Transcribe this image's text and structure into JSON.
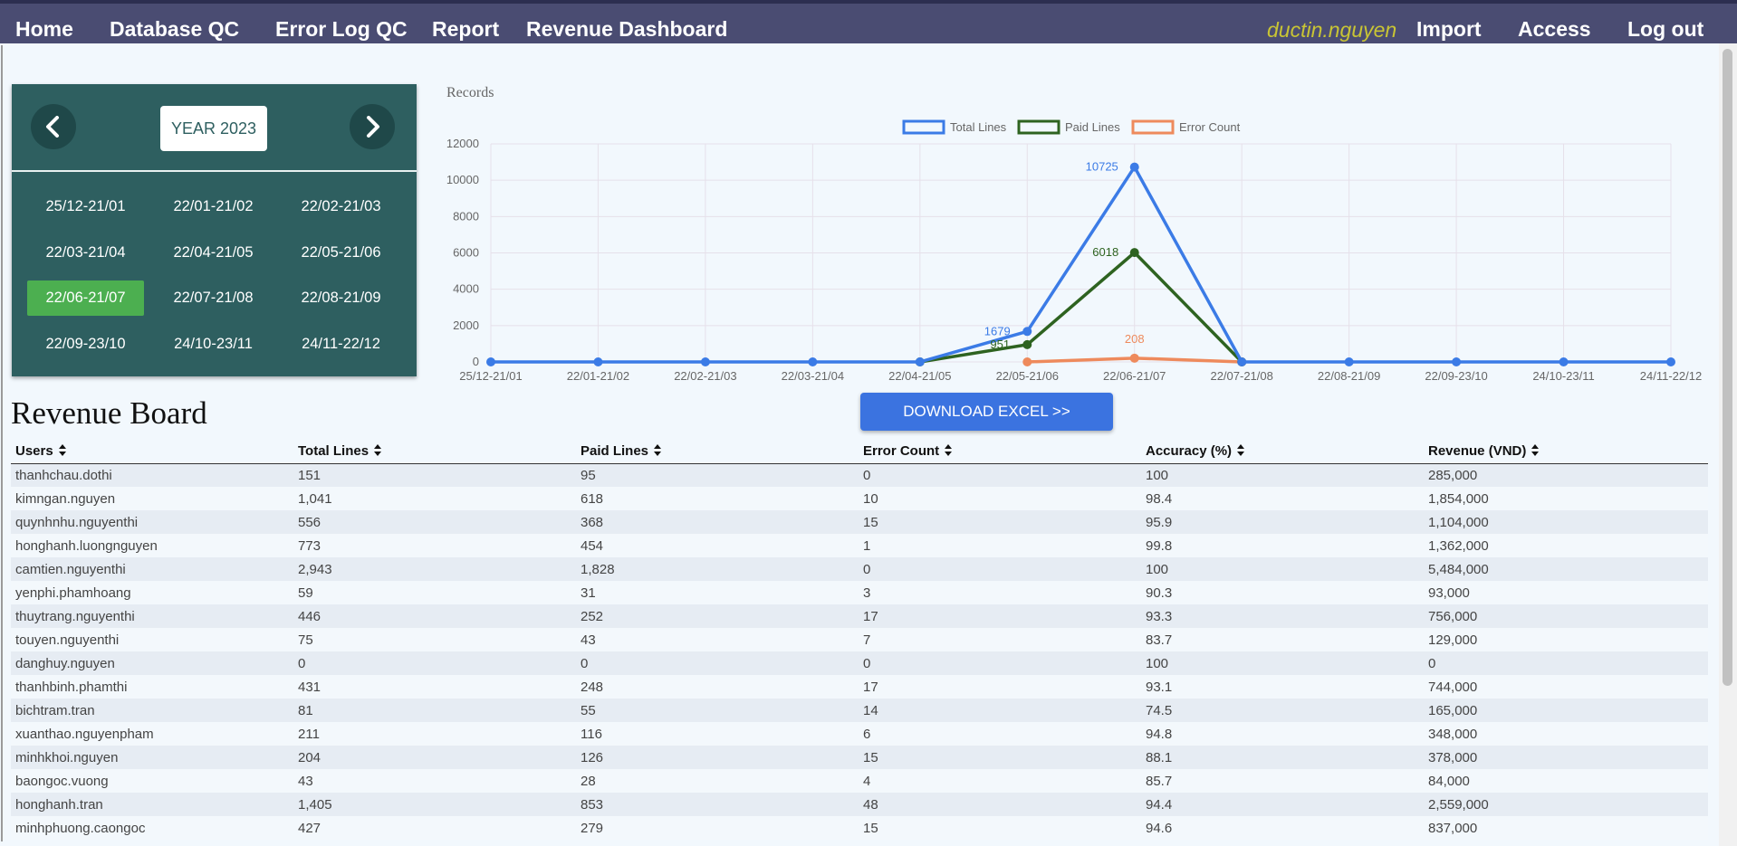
{
  "nav": {
    "items": [
      "Home",
      "Database QC",
      "Error Log QC",
      "Report",
      "Revenue Dashboard"
    ],
    "user": "ductin.nguyen",
    "right_items": [
      "Import",
      "Access",
      "Log out"
    ]
  },
  "calendar": {
    "year_label": "YEAR 2023",
    "periods": [
      "25/12-21/01",
      "22/01-21/02",
      "22/02-21/03",
      "22/03-21/04",
      "22/04-21/05",
      "22/05-21/06",
      "22/06-21/07",
      "22/07-21/08",
      "22/08-21/09",
      "22/09-23/10",
      "24/10-23/11",
      "24/11-22/12"
    ],
    "active_index": 6,
    "active_color": "#4caf50"
  },
  "chart_data": {
    "type": "line",
    "title": "Records",
    "categories": [
      "25/12-21/01",
      "22/01-21/02",
      "22/02-21/03",
      "22/03-21/04",
      "22/04-21/05",
      "22/05-21/06",
      "22/06-21/07",
      "22/07-21/08",
      "22/08-21/09",
      "22/09-23/10",
      "24/10-23/11",
      "24/11-22/12"
    ],
    "ylim": [
      0,
      12000
    ],
    "yticks": [
      0,
      2000,
      4000,
      6000,
      8000,
      10000,
      12000
    ],
    "grid": true,
    "legend": "top",
    "series": [
      {
        "name": "Total Lines",
        "color": "#3b7be6",
        "values": [
          0,
          0,
          0,
          0,
          0,
          1679,
          10725,
          0,
          0,
          0,
          0,
          0
        ],
        "labels": [
          null,
          null,
          null,
          null,
          null,
          "1679",
          "10725",
          null,
          null,
          null,
          null,
          null
        ]
      },
      {
        "name": "Paid Lines",
        "color": "#2e6320",
        "values": [
          null,
          null,
          null,
          null,
          0,
          951,
          6018,
          0,
          null,
          null,
          null,
          null
        ],
        "labels": [
          null,
          null,
          null,
          null,
          null,
          "951",
          "6018",
          null,
          null,
          null,
          null,
          null
        ]
      },
      {
        "name": "Error Count",
        "color": "#ee8a5c",
        "values": [
          null,
          null,
          null,
          null,
          null,
          0,
          208,
          0,
          null,
          null,
          null,
          null
        ],
        "labels": [
          null,
          null,
          null,
          null,
          null,
          null,
          "208",
          null,
          null,
          null,
          null,
          null
        ]
      }
    ]
  },
  "download_label": "DOWNLOAD EXCEL >>",
  "board": {
    "title": "Revenue Board",
    "columns": [
      "Users",
      "Total Lines",
      "Paid Lines",
      "Error Count",
      "Accuracy (%)",
      "Revenue (VND)"
    ],
    "rows": [
      [
        "thanhchau.dothi",
        "151",
        "95",
        "0",
        "100",
        "285,000"
      ],
      [
        "kimngan.nguyen",
        "1,041",
        "618",
        "10",
        "98.4",
        "1,854,000"
      ],
      [
        "quynhnhu.nguyenthi",
        "556",
        "368",
        "15",
        "95.9",
        "1,104,000"
      ],
      [
        "honghanh.luongnguyen",
        "773",
        "454",
        "1",
        "99.8",
        "1,362,000"
      ],
      [
        "camtien.nguyenthi",
        "2,943",
        "1,828",
        "0",
        "100",
        "5,484,000"
      ],
      [
        "yenphi.phamhoang",
        "59",
        "31",
        "3",
        "90.3",
        "93,000"
      ],
      [
        "thuytrang.nguyenthi",
        "446",
        "252",
        "17",
        "93.3",
        "756,000"
      ],
      [
        "touyen.nguyenthi",
        "75",
        "43",
        "7",
        "83.7",
        "129,000"
      ],
      [
        "danghuy.nguyen",
        "0",
        "0",
        "0",
        "100",
        "0"
      ],
      [
        "thanhbinh.phamthi",
        "431",
        "248",
        "17",
        "93.1",
        "744,000"
      ],
      [
        "bichtram.tran",
        "81",
        "55",
        "14",
        "74.5",
        "165,000"
      ],
      [
        "xuanthao.nguyenpham",
        "211",
        "116",
        "6",
        "94.8",
        "348,000"
      ],
      [
        "minhkhoi.nguyen",
        "204",
        "126",
        "15",
        "88.1",
        "378,000"
      ],
      [
        "baongoc.vuong",
        "43",
        "28",
        "4",
        "85.7",
        "84,000"
      ],
      [
        "honghanh.tran",
        "1,405",
        "853",
        "48",
        "94.4",
        "2,559,000"
      ],
      [
        "minhphuong.caongoc",
        "427",
        "279",
        "15",
        "94.6",
        "837,000"
      ]
    ]
  }
}
